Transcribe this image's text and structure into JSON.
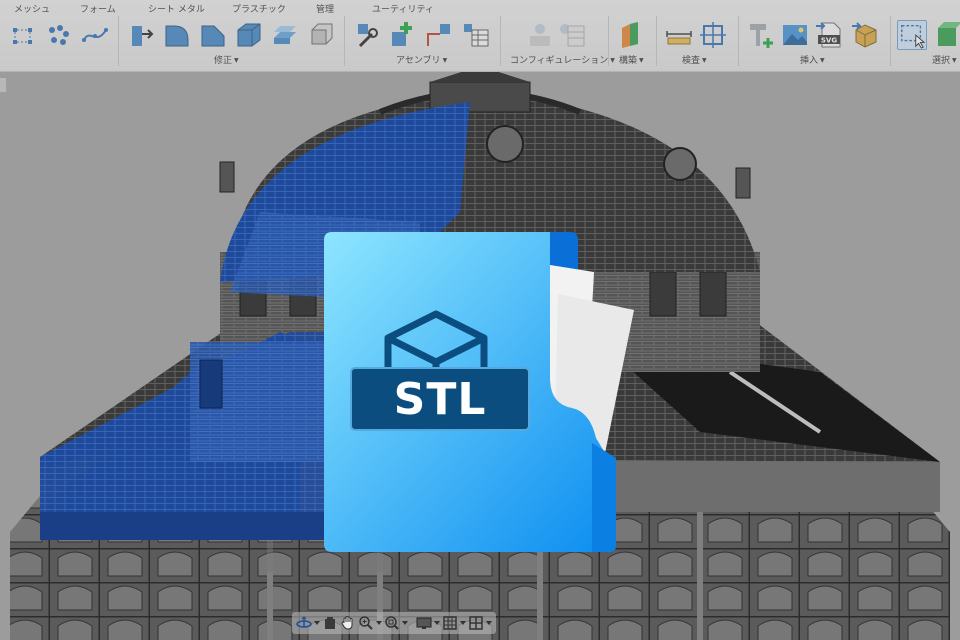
{
  "toolbar": {
    "tabs": [
      "メッシュ",
      "フォーム",
      "シート メタル",
      "プラスチック",
      "管理",
      "ユーティリティ"
    ],
    "groups": [
      "修正",
      "アセンブリ",
      "コンフィギュレーション",
      "構築",
      "検査",
      "挿入",
      "選択"
    ],
    "icons": {
      "box": "box-icon",
      "svg_label": "SVG"
    }
  },
  "file_badge": {
    "label": "STL"
  },
  "navbar": {
    "items": [
      "orbit-icon",
      "pan-hand-icon",
      "zoom-icon",
      "fit-window-icon",
      "display-settings-icon",
      "grid-icon",
      "viewports-icon"
    ]
  },
  "colors": {
    "accent_blue": "#1e88e5",
    "file_gradient_top": "#8ee6ff",
    "file_gradient_bottom": "#0b8df0",
    "badge_bg": "#0c4d7f",
    "model_blue": "#1f4a9a",
    "model_gray": "#4a4a4a"
  }
}
